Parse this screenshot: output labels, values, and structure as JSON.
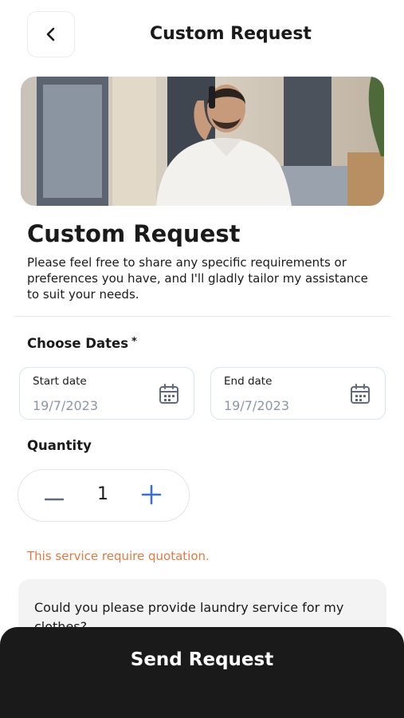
{
  "header": {
    "title": "Custom Request",
    "back_icon": "chevron-left-icon"
  },
  "hero": {
    "image": "man-on-phone-photo"
  },
  "main": {
    "title": "Custom Request",
    "description": "Please feel free to share any specific requirements or preferences you have, and I'll gladly tailor my assistance to suit your needs."
  },
  "dates": {
    "label": "Choose Dates",
    "required_mark": "*",
    "start": {
      "label": "Start date",
      "value": "19/7/2023",
      "icon": "calendar-icon"
    },
    "end": {
      "label": "End date",
      "value": "19/7/2023",
      "icon": "calendar-icon"
    }
  },
  "quantity": {
    "label": "Quantity",
    "value": "1",
    "minus_icon": "minus-icon",
    "plus_icon": "plus-icon"
  },
  "notice": "This service require quotation.",
  "message": {
    "value": "Could you please provide laundry service for my clothes?"
  },
  "submit": {
    "label": "Send Request"
  },
  "colors": {
    "accent_blue": "#3b6fd8",
    "notice_orange": "#e07a44",
    "dark_bar": "#1a1a1a"
  }
}
